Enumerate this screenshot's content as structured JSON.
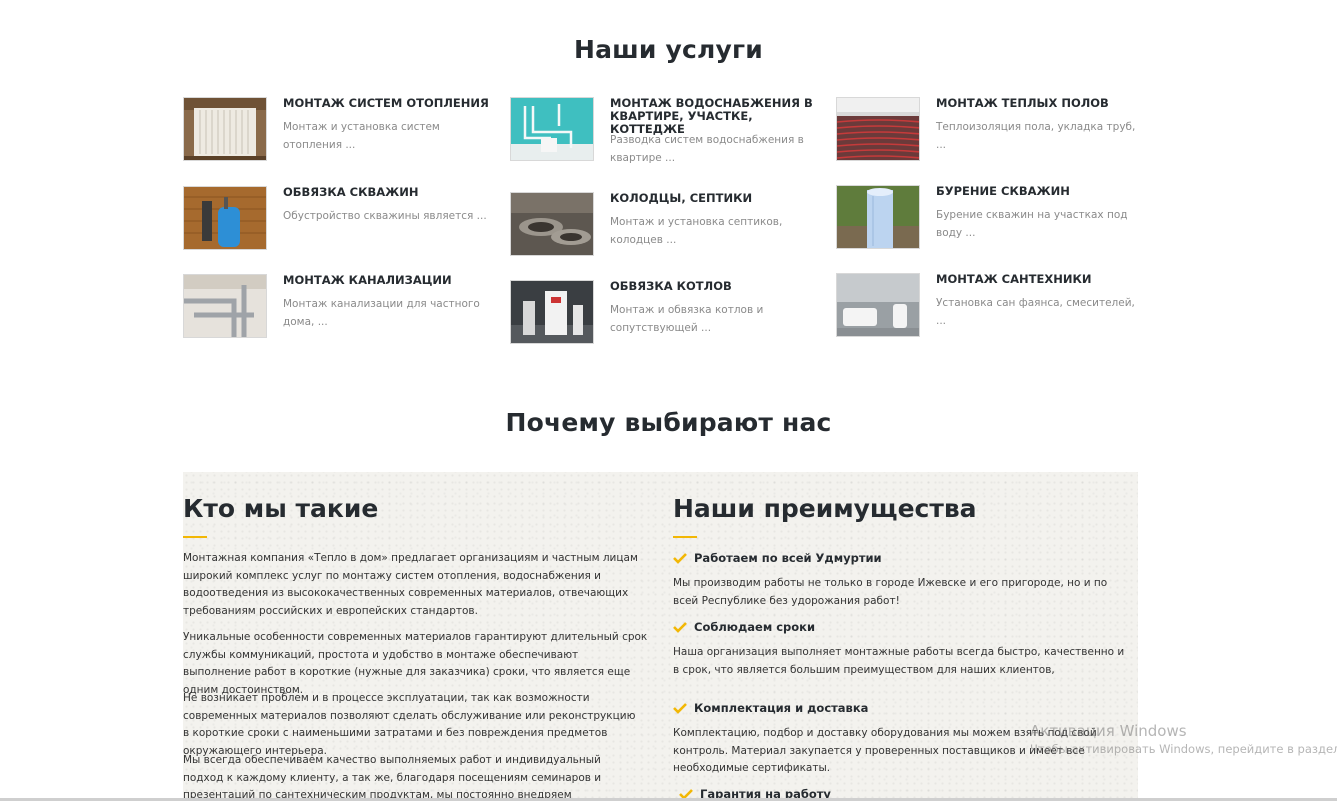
{
  "services": {
    "title": "Наши услуги",
    "items": [
      {
        "title": "МОНТАЖ СИСТЕМ ОТОПЛЕНИЯ",
        "desc": " Монтаж и установка систем отопления ...",
        "image": "radiator"
      },
      {
        "title": "МОНТАЖ ВОДОСНАБЖЕНИЯ В КВАРТИРЕ, УЧАСТКЕ, КОТТЕДЖЕ",
        "desc": "Разводка систем водоснабжения в квартире ...",
        "image": "water-pipes"
      },
      {
        "title": "МОНТАЖ ТЕПЛЫХ ПОЛОВ",
        "desc": "Теплоизоляция пола, укладка труб, ...",
        "image": "floor-heating"
      },
      {
        "title": "ОБВЯЗКА СКВАЖИН",
        "desc": " Обустройство скважины является ...",
        "image": "well-tank"
      },
      {
        "title": "КОЛОДЦЫ, СЕПТИКИ",
        "desc": "Монтаж и установка септиков, колодцев ...",
        "image": "concrete-rings"
      },
      {
        "title": "БУРЕНИЕ СКВАЖИН",
        "desc": "Бурение скважин на участках под воду ...",
        "image": "well-pipe"
      },
      {
        "title": "МОНТАЖ КАНАЛИЗАЦИИ",
        "desc": "Монтаж канализации для частного дома, ...",
        "image": "sewer-pipes"
      },
      {
        "title": "ОБВЯЗКА КОТЛОВ",
        "desc": "Монтаж и обвязка котлов и сопутствующей ...",
        "image": "boiler-room"
      },
      {
        "title": "МОНТАЖ САНТЕХНИКИ",
        "desc": "Установка сан фаянса, смесителей, ...",
        "image": "bathroom"
      }
    ]
  },
  "why": {
    "title": "Почему выбирают нас",
    "about": {
      "heading": "Кто мы такие",
      "paragraphs": [
        "Монтажная компания «Тепло в дом» предлагает организациям и частным лицам широкий комплекс услуг по монтажу систем отопления, водоснабжения и водоотведения из высококачественных современных материалов, отвечающих требованиям российских и европейских стандартов.",
        "Уникальные особенности современных материалов гарантируют длительный срок службы коммуникаций, простота и удобство в монтаже обеспечивают выполнение работ в короткие (нужные для заказчика) сроки, что является еще одним достоинством.",
        "Не возникает проблем и в процессе эксплуатации, так как возможности современных материалов позволяют сделать обслуживание или реконструкцию в короткие сроки с наименьшими затратами и без повреждения предметов окружающего интерьера.",
        "Мы всегда обеспечиваем качество выполняемых работ и индивидуальный подход к каждому клиенту, а так же, благодаря посещениям семинаров и презентаций по сантехническим продуктам, мы постоянно внедряем рациональные и инновационные"
      ]
    },
    "advantages": {
      "heading": "Наши преимущества",
      "items": [
        {
          "title": "Работаем по всей  Удмуртии",
          "text": "Мы производим работы не только в  городе Ижевске и его пригороде, но и по всей Республике без удорожания работ!"
        },
        {
          "title": "Соблюдаем сроки",
          "text": "Наша организация выполняет монтажные работы всегда быстро, качественно и в срок, что является большим преимуществом для наших клиентов,"
        },
        {
          "title": "Комплектация и доставка",
          "text": "Комплектацию, подбор и доставку оборудования мы можем взять под свой контроль. Материал закупается у проверенных поставщиков и имеет все необходимые сертификаты."
        },
        {
          "title": "Гарантия на работу",
          "text": ""
        }
      ]
    }
  },
  "watermark": {
    "line1": "Активация Windows",
    "line2": "Чтобы активировать Windows, перейдите в раздел \"П"
  },
  "colors": {
    "accent": "#f2b705",
    "heading": "#262b30",
    "muted": "#8a8a8a"
  }
}
